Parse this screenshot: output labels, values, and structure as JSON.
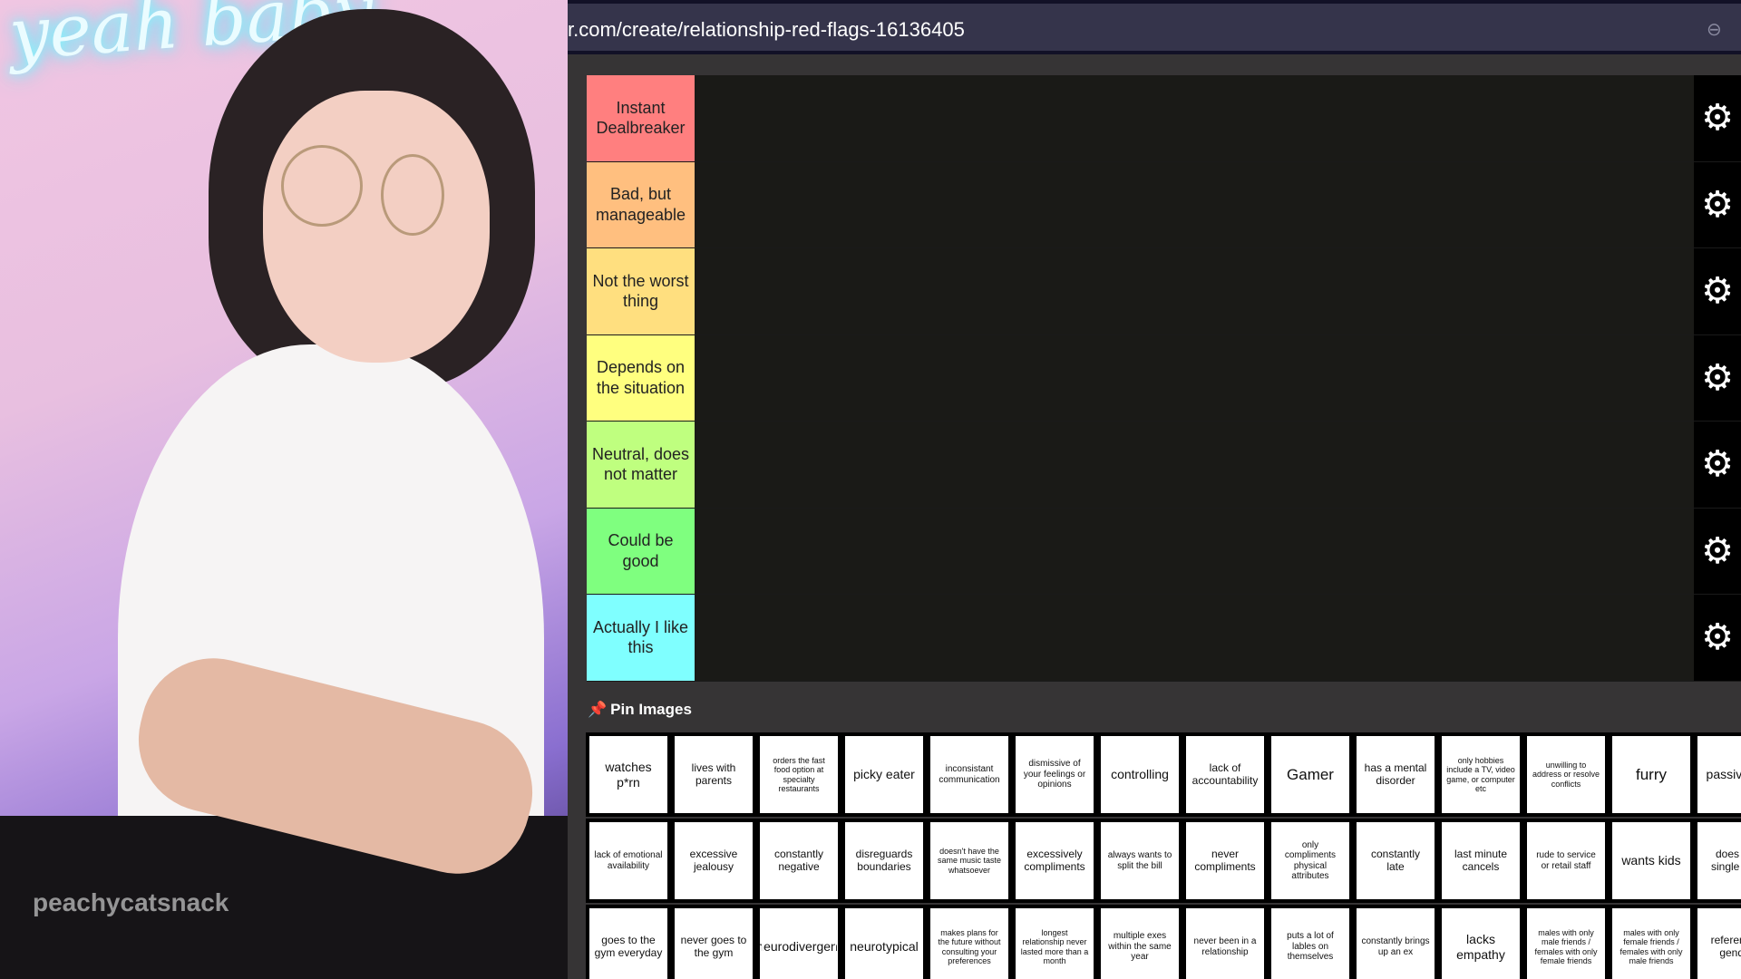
{
  "stream": {
    "neon_sign": "yeah baby",
    "watermark": "peachycatsnack"
  },
  "browser": {
    "url": "r.com/create/relationship-red-flags-16136405",
    "zoom_icon": "zoom-out-icon"
  },
  "tiers": [
    {
      "label": "Instant Dealbreaker",
      "color": "#ff7f7f"
    },
    {
      "label": "Bad, but manageable",
      "color": "#ffbf7f"
    },
    {
      "label": "Not the worst thing",
      "color": "#ffdf7f"
    },
    {
      "label": "Depends on the situation",
      "color": "#ffff7f"
    },
    {
      "label": "Neutral, does not matter",
      "color": "#bfff7f"
    },
    {
      "label": "Could be good",
      "color": "#7fff7f"
    },
    {
      "label": "Actually I like this",
      "color": "#7fffff"
    }
  ],
  "pin": {
    "label": "Pin Images",
    "icon": "pushpin-icon"
  },
  "pool": [
    [
      "watches p*rn",
      "lives with parents",
      "orders the fast food option at specialty restaurants",
      "picky eater",
      "inconsistant communication",
      "dismissive of your feelings or opinions",
      "controlling",
      "lack of accountability",
      "Gamer",
      "has a mental disorder",
      "only hobbies include a TV, video game, or computer etc",
      "unwilling to address or resolve conflicts",
      "furry",
      "passive ag"
    ],
    [
      "lack of emotional availability",
      "excessive jealousy",
      "constantly negative",
      "disreguards boundaries",
      "doesn't have the same music taste whatsoever",
      "excessively compliments",
      "always wants to split the bill",
      "never compliments",
      "only compliments physical attributes",
      "constantly late",
      "last minute cancels",
      "rude to service or retail staff",
      "wants kids",
      "does not single clos"
    ],
    [
      "goes to the gym everyday",
      "never goes to the gym",
      "neurodivergent",
      "neurotypical",
      "makes plans for the future without consulting your preferences",
      "longest relationship never lasted more than a month",
      "multiple exes within the same year",
      "never been in a relationship",
      "puts a lot of lables on themselves",
      "constantly brings up an ex",
      "lacks empathy",
      "males with only male friends / females with only female friends",
      "males with only female friends / females with only male friends",
      "references gender"
    ]
  ]
}
